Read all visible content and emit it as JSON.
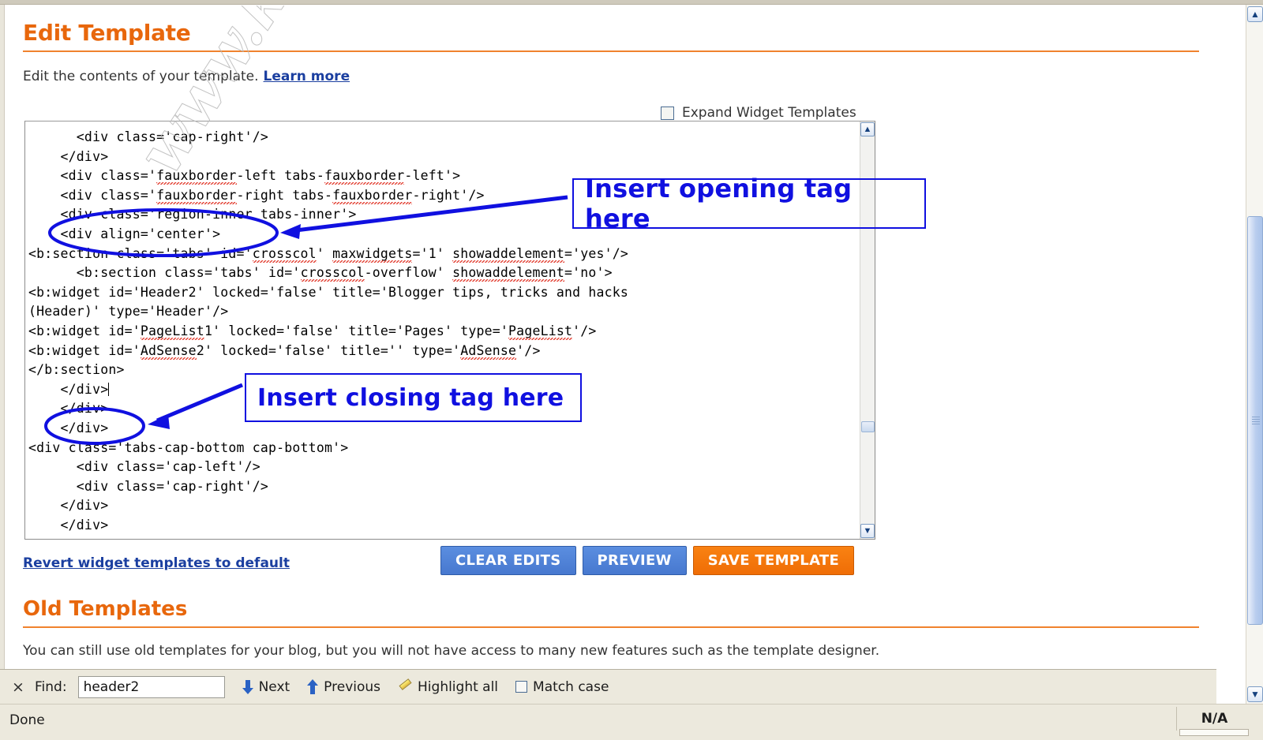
{
  "page": {
    "title": "Edit Template",
    "intro_text": "Edit the contents of your template.",
    "learn_more": "Learn more",
    "expand_checkbox_label": "Expand Widget Templates",
    "old_templates_heading": "Old Templates",
    "old_templates_text": "You can still use old templates for your blog, but you will not have access to many new features such as the template designer.",
    "revert_link": "Revert widget templates to default"
  },
  "buttons": {
    "clear_edits": "CLEAR EDITS",
    "preview": "PREVIEW",
    "save_template": "SAVE TEMPLATE"
  },
  "editor": {
    "lines": [
      "      <div class='cap-right'/>",
      "    </div>",
      "    <div class='fauxborder-left tabs-fauxborder-left'>",
      "    <div class='fauxborder-right tabs-fauxborder-right'/>",
      "    <div class='region-inner tabs-inner'>",
      "    <div align='center'>",
      "<b:section class='tabs' id='crosscol' maxwidgets='1' showaddelement='yes'/>",
      "      <b:section class='tabs' id='crosscol-overflow' showaddelement='no'>",
      "<b:widget id='Header2' locked='false' title='Blogger tips, tricks and hacks",
      "(Header)' type='Header'/>",
      "<b:widget id='PageList1' locked='false' title='Pages' type='PageList'/>",
      "<b:widget id='AdSense2' locked='false' title='' type='AdSense'/>",
      "</b:section>",
      "    </div>",
      "    </div>",
      "    </div>",
      "<div class='tabs-cap-bottom cap-bottom'>",
      "      <div class='cap-left'/>",
      "      <div class='cap-right'/>",
      "    </div>",
      "    </div>"
    ]
  },
  "annotations": {
    "opening": "Insert opening tag here",
    "closing": "Insert closing tag here"
  },
  "watermark": {
    "text": "www.khairulinetworks.tk"
  },
  "findbar": {
    "close_icon": "×",
    "label": "Find:",
    "value": "header2",
    "placeholder": "",
    "next": "Next",
    "previous": "Previous",
    "highlight_all": "Highlight all",
    "match_case": "Match case"
  },
  "statusbar": {
    "status": "Done",
    "right_value": "N/A"
  },
  "colors": {
    "heading_orange": "#e8670c",
    "link_blue": "#1b3fa0",
    "annotation_blue": "#1010e0",
    "button_blue": "#4778cf",
    "button_orange": "#ef6d06"
  }
}
